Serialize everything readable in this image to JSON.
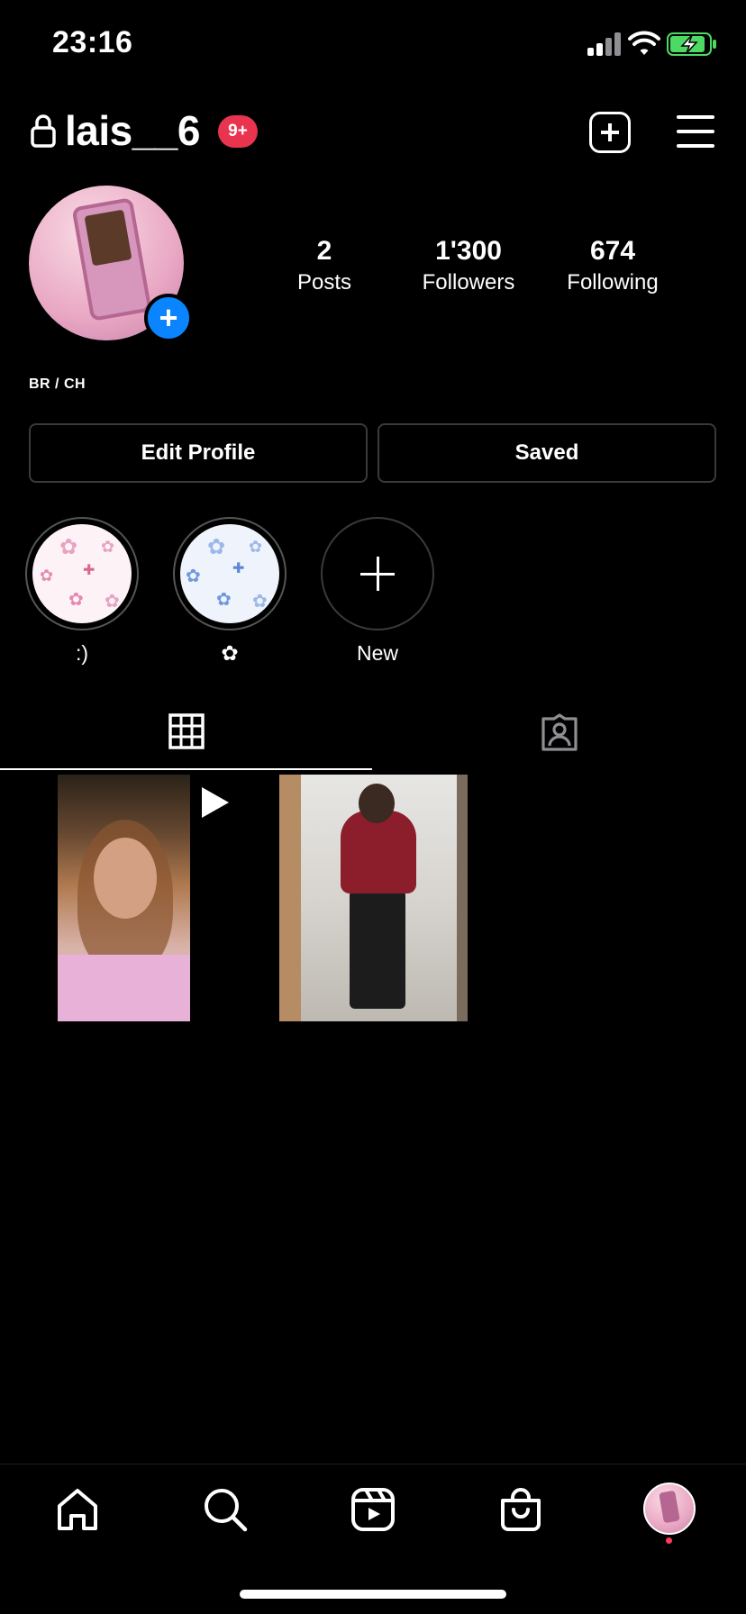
{
  "status_bar": {
    "time": "23:16"
  },
  "header": {
    "username": "lais__6",
    "notification_badge": "9+"
  },
  "profile": {
    "stats": [
      {
        "value": "2",
        "label": "Posts"
      },
      {
        "value": "1'300",
        "label": "Followers"
      },
      {
        "value": "674",
        "label": "Following"
      }
    ],
    "bio": "BR / CH",
    "buttons": {
      "edit_profile": "Edit Profile",
      "saved": "Saved"
    }
  },
  "highlights": [
    {
      "label": ":)"
    },
    {
      "label": "✿"
    },
    {
      "label": "New"
    }
  ],
  "tabs": {
    "active": "grid"
  },
  "nav": {
    "active": "profile"
  },
  "colors": {
    "badge": "#e8344e",
    "accent_blue": "#0a84ff",
    "battery": "#4cd964"
  }
}
